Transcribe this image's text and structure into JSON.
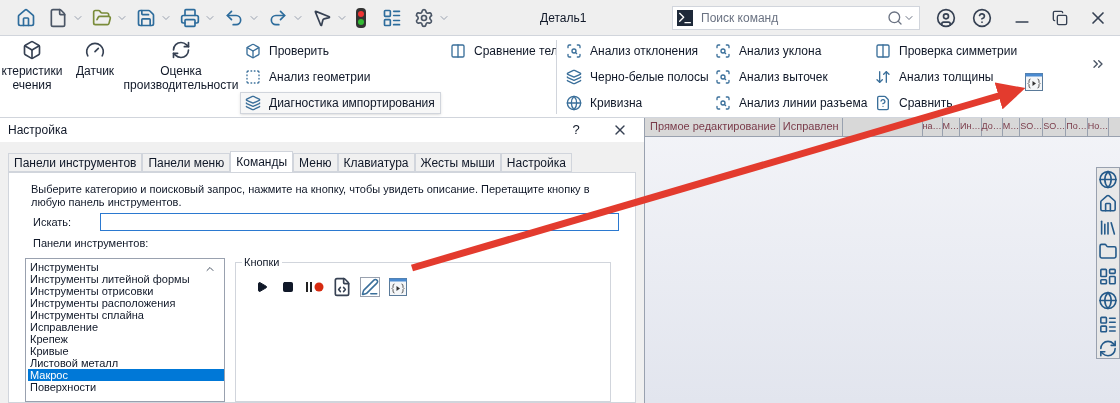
{
  "window": {
    "title": "Деталь1"
  },
  "command_search": {
    "placeholder": "Поиск команд"
  },
  "ribbon": {
    "large_buttons": [
      {
        "label": "ктеристики ечения"
      },
      {
        "label": "Датчик"
      },
      {
        "label": "Оценка производительности"
      }
    ],
    "columns": [
      [
        {
          "label": "Проверить",
          "hovered": false
        },
        {
          "label": "Анализ геометрии",
          "hovered": false
        },
        {
          "label": "Диагностика импортирования",
          "hovered": true
        }
      ],
      [
        {
          "label": "Сравнение тел",
          "hovered": false
        }
      ],
      [
        {
          "label": "Анализ отклонения",
          "hovered": false
        },
        {
          "label": "Черно-белые полосы",
          "hovered": false
        },
        {
          "label": "Кривизна",
          "hovered": false
        }
      ],
      [
        {
          "label": "Анализ уклона",
          "hovered": false
        },
        {
          "label": "Анализ выточек",
          "hovered": false
        },
        {
          "label": "Анализ линии разъема",
          "hovered": false
        }
      ],
      [
        {
          "label": "Проверка симметрии",
          "hovered": false
        },
        {
          "label": "Анализ толщины",
          "hovered": false
        },
        {
          "label": "Сравнить",
          "hovered": false
        }
      ]
    ]
  },
  "dialog": {
    "title": "Настройка",
    "help": "?",
    "tabs": [
      {
        "label": "Панели инструментов",
        "selected": false
      },
      {
        "label": "Панели меню",
        "selected": false
      },
      {
        "label": "Команды",
        "selected": true
      },
      {
        "label": "Меню",
        "selected": false
      },
      {
        "label": "Клавиатура",
        "selected": false
      },
      {
        "label": "Жесты мыши",
        "selected": false
      },
      {
        "label": "Настройка",
        "selected": false
      }
    ],
    "description": "Выберите категорию и поисковый запрос, нажмите на кнопку, чтобы увидеть описание. Перетащите кнопку в любую панель инструментов.",
    "search_label": "Искать:",
    "toolbars_label": "Панели инструментов:",
    "toolbars": [
      {
        "label": "Инструменты",
        "selected": false
      },
      {
        "label": "Инструменты литейной формы",
        "selected": false
      },
      {
        "label": "Инструменты отрисовки",
        "selected": false
      },
      {
        "label": "Инструменты расположения",
        "selected": false
      },
      {
        "label": "Инструменты сплайна",
        "selected": false
      },
      {
        "label": "Исправление",
        "selected": false
      },
      {
        "label": "Крепеж",
        "selected": false
      },
      {
        "label": "Кривые",
        "selected": false
      },
      {
        "label": "Листовой металл",
        "selected": false
      },
      {
        "label": "Макрос",
        "selected": true
      },
      {
        "label": "Поверхности",
        "selected": false
      }
    ],
    "buttons_group": "Кнопки"
  },
  "document_tabs": [
    {
      "label": "Прямое редактирование"
    },
    {
      "label": "Исправлен"
    },
    {
      "label": "на…"
    },
    {
      "label": "М…"
    },
    {
      "label": "Ин…"
    },
    {
      "label": "До…"
    },
    {
      "label": "М…"
    },
    {
      "label": "SO…"
    },
    {
      "label": "SO…"
    },
    {
      "label": "По…"
    },
    {
      "label": "Но…"
    }
  ]
}
